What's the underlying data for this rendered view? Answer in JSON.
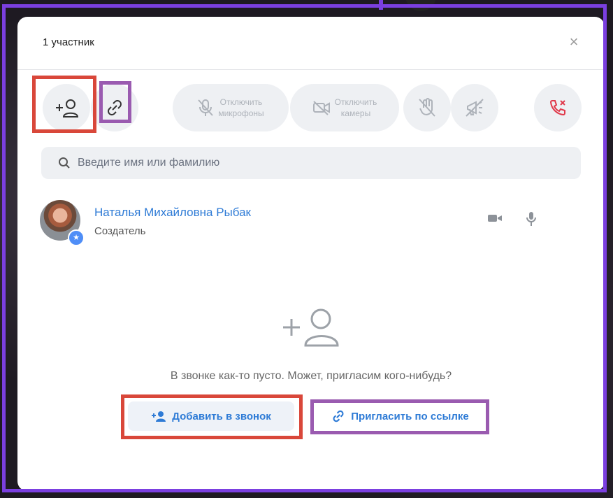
{
  "dialog": {
    "title": "1 участник",
    "close_label": "×"
  },
  "toolbar": {
    "add_participant_icon": "person-plus-icon",
    "copy_link_icon": "link-icon",
    "mute_mics": {
      "label_line1": "Отключить",
      "label_line2": "микрофоны",
      "icon": "mic-off-icon"
    },
    "mute_cams": {
      "label_line1": "Отключить",
      "label_line2": "камеры",
      "icon": "camera-off-icon"
    },
    "hand_icon": "hand-off-icon",
    "announce_icon": "megaphone-off-icon",
    "end_call_icon": "phone-end-icon",
    "end_call_color": "#e0394a"
  },
  "search": {
    "placeholder": "Введите имя или фамилию"
  },
  "participant": {
    "name": "Наталья Михайловна Рыбак",
    "role": "Создатель",
    "badge_icon": "star-icon"
  },
  "empty_state": {
    "icon": "person-plus-icon",
    "text": "В звонке как-то пусто. Может, пригласим кого-нибудь?"
  },
  "actions": {
    "add_to_call": "Добавить в звонок",
    "invite_by_link": "Пригласить по ссылке"
  },
  "colors": {
    "accent": "#2e7bd6",
    "frame_purple": "#7b3fe0",
    "highlight_red": "#d9473a",
    "highlight_purple": "#9a5bb0"
  }
}
